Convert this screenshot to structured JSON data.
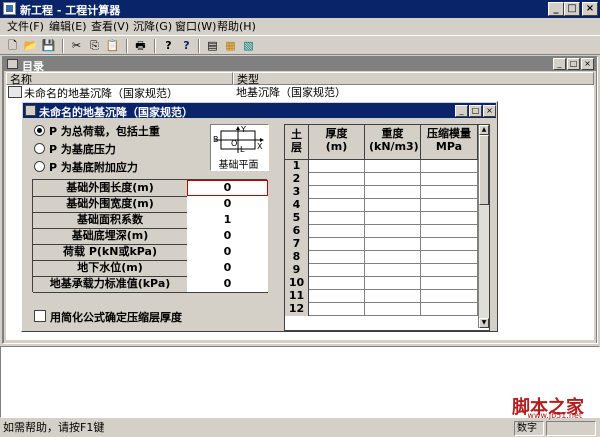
{
  "window": {
    "title": "新工程 - 工程计算器",
    "minimize": "_",
    "maximize": "□",
    "close": "×"
  },
  "menu": [
    "文件(F)",
    "编辑(E)",
    "查看(V)",
    "沉降(G)",
    "窗口(W)",
    "帮助(H)"
  ],
  "toolbar": {
    "new": "🗋",
    "open": "📂",
    "save": "💾",
    "cut": "✂",
    "copy": "⎘",
    "paste": "📋",
    "print": "🖶",
    "help": "?",
    "context_help": "?",
    "tool_a": "▤",
    "tool_b": "▦",
    "tool_c": "▧"
  },
  "directory": {
    "title": "目录",
    "columns": {
      "name": "名称",
      "type": "类型"
    },
    "rows": [
      {
        "name": "未命名的地基沉降（国家规范）",
        "type": "地基沉降（国家规范）"
      }
    ]
  },
  "dialog": {
    "title": "未命名的地基沉降（国家规范）",
    "radio_options": [
      {
        "label": "P 为总荷载，包括土重",
        "selected": true
      },
      {
        "label": "P 为基底压力",
        "selected": false
      },
      {
        "label": "P 为基底附加应力",
        "selected": false
      }
    ],
    "diagram": {
      "label": "基础平面",
      "axis_b": "B",
      "axis_y": "Y",
      "axis_x": "X",
      "origin": "O",
      "axis_l": "L"
    },
    "params": [
      {
        "label": "基础外围长度(m)",
        "value": "0"
      },
      {
        "label": "基础外围宽度(m)",
        "value": "0"
      },
      {
        "label": "基础面积系数",
        "value": "1"
      },
      {
        "label": "基础底埋深(m)",
        "value": "0"
      },
      {
        "label": "荷载 P(kN或kPa)",
        "value": "0"
      },
      {
        "label": "地下水位(m)",
        "value": "0"
      },
      {
        "label": "地基承载力标准值(kPa)",
        "value": "0"
      }
    ],
    "checkbox_label": "用简化公式确定压缩层厚度",
    "grid": {
      "headers": {
        "layer": "土层",
        "thickness": "厚度(m)",
        "density": "重度(kN/m3)",
        "modulus": "压缩模量MPa"
      },
      "rows": [
        "1",
        "2",
        "3",
        "4",
        "5",
        "6",
        "7",
        "8",
        "9",
        "10",
        "11",
        "12"
      ]
    }
  },
  "status": {
    "help": "如需帮助，请按F1键",
    "mode": "数字"
  },
  "watermark": {
    "text": "脚本之家",
    "url": "www.jb51.net"
  },
  "colors": {
    "titlebar": "#0a246a",
    "face": "#d4d0c8",
    "inactive_title": "#808080"
  }
}
